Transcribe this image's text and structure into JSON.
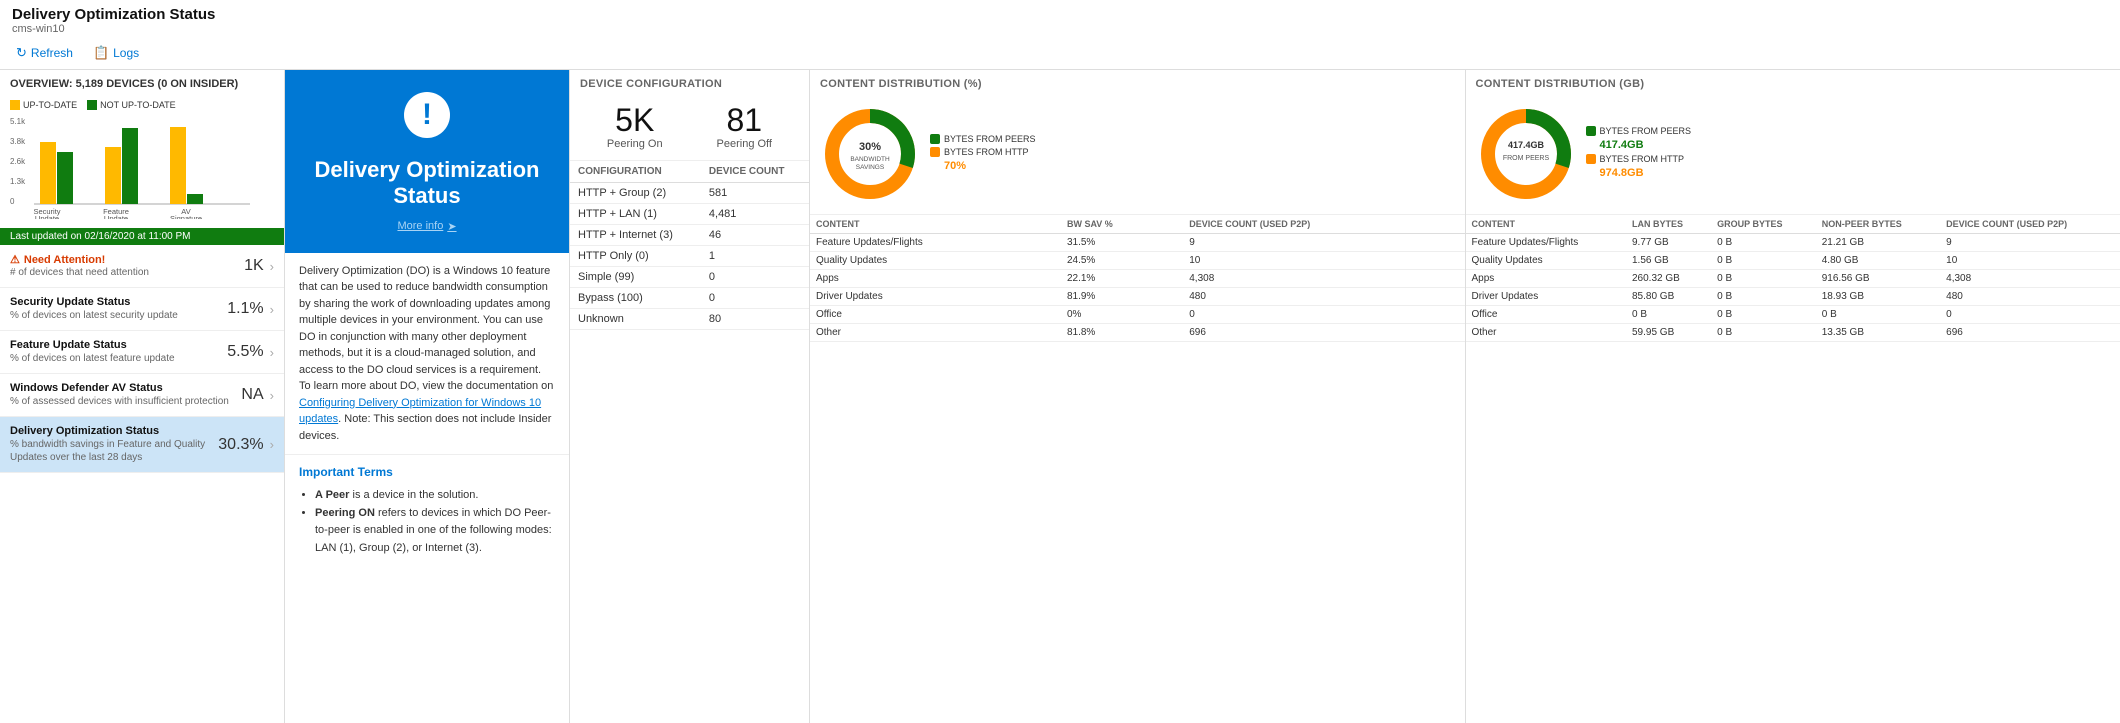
{
  "header": {
    "title": "Delivery Optimization Status",
    "subtitle": "cms-win10",
    "refresh_label": "Refresh",
    "logs_label": "Logs"
  },
  "overview": {
    "title": "OVERVIEW: 5,189 DEVICES (0 ON INSIDER)",
    "legend": {
      "up_to_date": "UP-TO-DATE",
      "not_up_to_date": "NOT UP-TO-DATE"
    },
    "chart": {
      "y_labels": [
        "5.1k",
        "3.8k",
        "2.6k",
        "1.3k",
        "0"
      ],
      "groups": [
        {
          "label": "Security Update",
          "up": 60,
          "not_up": 45
        },
        {
          "label": "Feature Update",
          "up": 55,
          "not_up": 85
        },
        {
          "label": "AV Signature",
          "up": 85,
          "not_up": 10
        }
      ]
    },
    "status_update": "Last updated on 02/16/2020 at 11:00 PM",
    "nav_items": [
      {
        "id": "need-attention",
        "title": "Need Attention!",
        "desc": "# of devices that need attention",
        "value": "1K",
        "is_warning": true
      },
      {
        "id": "security-update",
        "title": "Security Update Status",
        "desc": "% of devices on latest security update",
        "value": "1.1%",
        "is_warning": false
      },
      {
        "id": "feature-update",
        "title": "Feature Update Status",
        "desc": "% of devices on latest feature update",
        "value": "5.5%",
        "is_warning": false
      },
      {
        "id": "av-status",
        "title": "Windows Defender AV Status",
        "desc": "% of assessed devices with insufficient protection",
        "value": "NA",
        "is_warning": false
      },
      {
        "id": "do-status",
        "title": "Delivery Optimization Status",
        "desc": "% bandwidth savings in Feature and Quality Updates over the last 28 days",
        "value": "30.3%",
        "is_warning": false,
        "active": true
      }
    ]
  },
  "do_card": {
    "icon": "!",
    "title": "Delivery Optimization Status",
    "link_text": "More info",
    "info_text": "Delivery Optimization (DO) is a Windows 10 feature that can be used to reduce bandwidth consumption by sharing the work of downloading updates among multiple devices in your environment. You can use DO in conjunction with many other deployment methods, but it is a cloud-managed solution, and access to the DO cloud services is a requirement. To learn more about DO, view the documentation on ",
    "link_text2": "Configuring Delivery Optimization for Windows 10 updates",
    "info_text2": ". Note: This section does not include Insider devices.",
    "important_terms_title": "Important Terms",
    "terms": [
      {
        "term": "A Peer",
        "definition": " is a device in the solution."
      },
      {
        "term": "Peering ON",
        "definition": " refers to devices in which DO Peer-to-peer is enabled in one of the following modes: LAN (1), Group (2), or Internet (3)."
      }
    ]
  },
  "device_config": {
    "panel_title": "DEVICE CONFIGURATION",
    "peering_on": {
      "label": "Peering On",
      "value": "5K"
    },
    "peering_off": {
      "label": "Peering Off",
      "value": "81"
    },
    "table_headers": [
      "CONFIGURATION",
      "DEVICE COUNT"
    ],
    "rows": [
      {
        "config": "HTTP + Group (2)",
        "count": "581"
      },
      {
        "config": "HTTP + LAN (1)",
        "count": "4,481"
      },
      {
        "config": "HTTP + Internet (3)",
        "count": "46"
      },
      {
        "config": "HTTP Only (0)",
        "count": "1"
      },
      {
        "config": "Simple (99)",
        "count": "0"
      },
      {
        "config": "Bypass (100)",
        "count": "0"
      },
      {
        "config": "Unknown",
        "count": "80"
      }
    ]
  },
  "content_dist_pct": {
    "panel_title": "CONTENT DISTRIBUTION (%)",
    "donut": {
      "center_label": "30%",
      "center_sub": "BANDWIDTH\nSAVINGS",
      "peers_pct": 30,
      "http_pct": 70,
      "legend": [
        {
          "label": "BYTES FROM PEERS",
          "color": "#107c10"
        },
        {
          "label": "BYTES FROM HTTP",
          "color": "#ff8c00"
        },
        {
          "label": "70%",
          "color": "#ff8c00"
        }
      ]
    },
    "table_headers": [
      "CONTENT",
      "BW SAV %",
      "DEVICE COUNT (USED P2P)"
    ],
    "rows": [
      {
        "content": "Feature Updates/Flights",
        "bw_sav": "31.5%",
        "device_count": "9"
      },
      {
        "content": "Quality Updates",
        "bw_sav": "24.5%",
        "device_count": "10"
      },
      {
        "content": "Apps",
        "bw_sav": "22.1%",
        "device_count": "4,308"
      },
      {
        "content": "Driver Updates",
        "bw_sav": "81.9%",
        "device_count": "480"
      },
      {
        "content": "Office",
        "bw_sav": "0%",
        "device_count": "0"
      },
      {
        "content": "Other",
        "bw_sav": "81.8%",
        "device_count": "696"
      }
    ]
  },
  "content_dist_gb": {
    "panel_title": "CONTENT DISTRIBUTION (GB)",
    "donut": {
      "center_label": "417.4GB",
      "center_sub": "FROM PEERS",
      "peers_gb": 417.4,
      "http_gb": 974.8,
      "legend": [
        {
          "label": "BYTES FROM PEERS",
          "color": "#107c10",
          "value": "417.4GB"
        },
        {
          "label": "BYTES FROM HTTP",
          "color": "#ff8c00",
          "value": "974.8GB"
        }
      ]
    },
    "table_headers": [
      "CONTENT",
      "LAN BYTES",
      "GROUP BYTES",
      "NON-PEER BYTES",
      "DEVICE COUNT (USED P2P)"
    ],
    "rows": [
      {
        "content": "Feature Updates/Flights",
        "lan": "9.77 GB",
        "group": "0 B",
        "non_peer": "21.21 GB",
        "device_count": "9"
      },
      {
        "content": "Quality Updates",
        "lan": "1.56 GB",
        "group": "0 B",
        "non_peer": "4.80 GB",
        "device_count": "10"
      },
      {
        "content": "Apps",
        "lan": "260.32 GB",
        "group": "0 B",
        "non_peer": "916.56 GB",
        "device_count": "4,308"
      },
      {
        "content": "Driver Updates",
        "lan": "85.80 GB",
        "group": "0 B",
        "non_peer": "18.93 GB",
        "device_count": "480"
      },
      {
        "content": "Office",
        "lan": "0 B",
        "group": "0 B",
        "non_peer": "0 B",
        "device_count": "0"
      },
      {
        "content": "Other",
        "lan": "59.95 GB",
        "group": "0 B",
        "non_peer": "13.35 GB",
        "device_count": "696"
      }
    ]
  },
  "colors": {
    "up_to_date": "#ffb900",
    "not_up_to_date": "#107c10",
    "peers": "#107c10",
    "http": "#ff8c00",
    "blue": "#0078d4",
    "active_nav": "#cce4f7"
  }
}
